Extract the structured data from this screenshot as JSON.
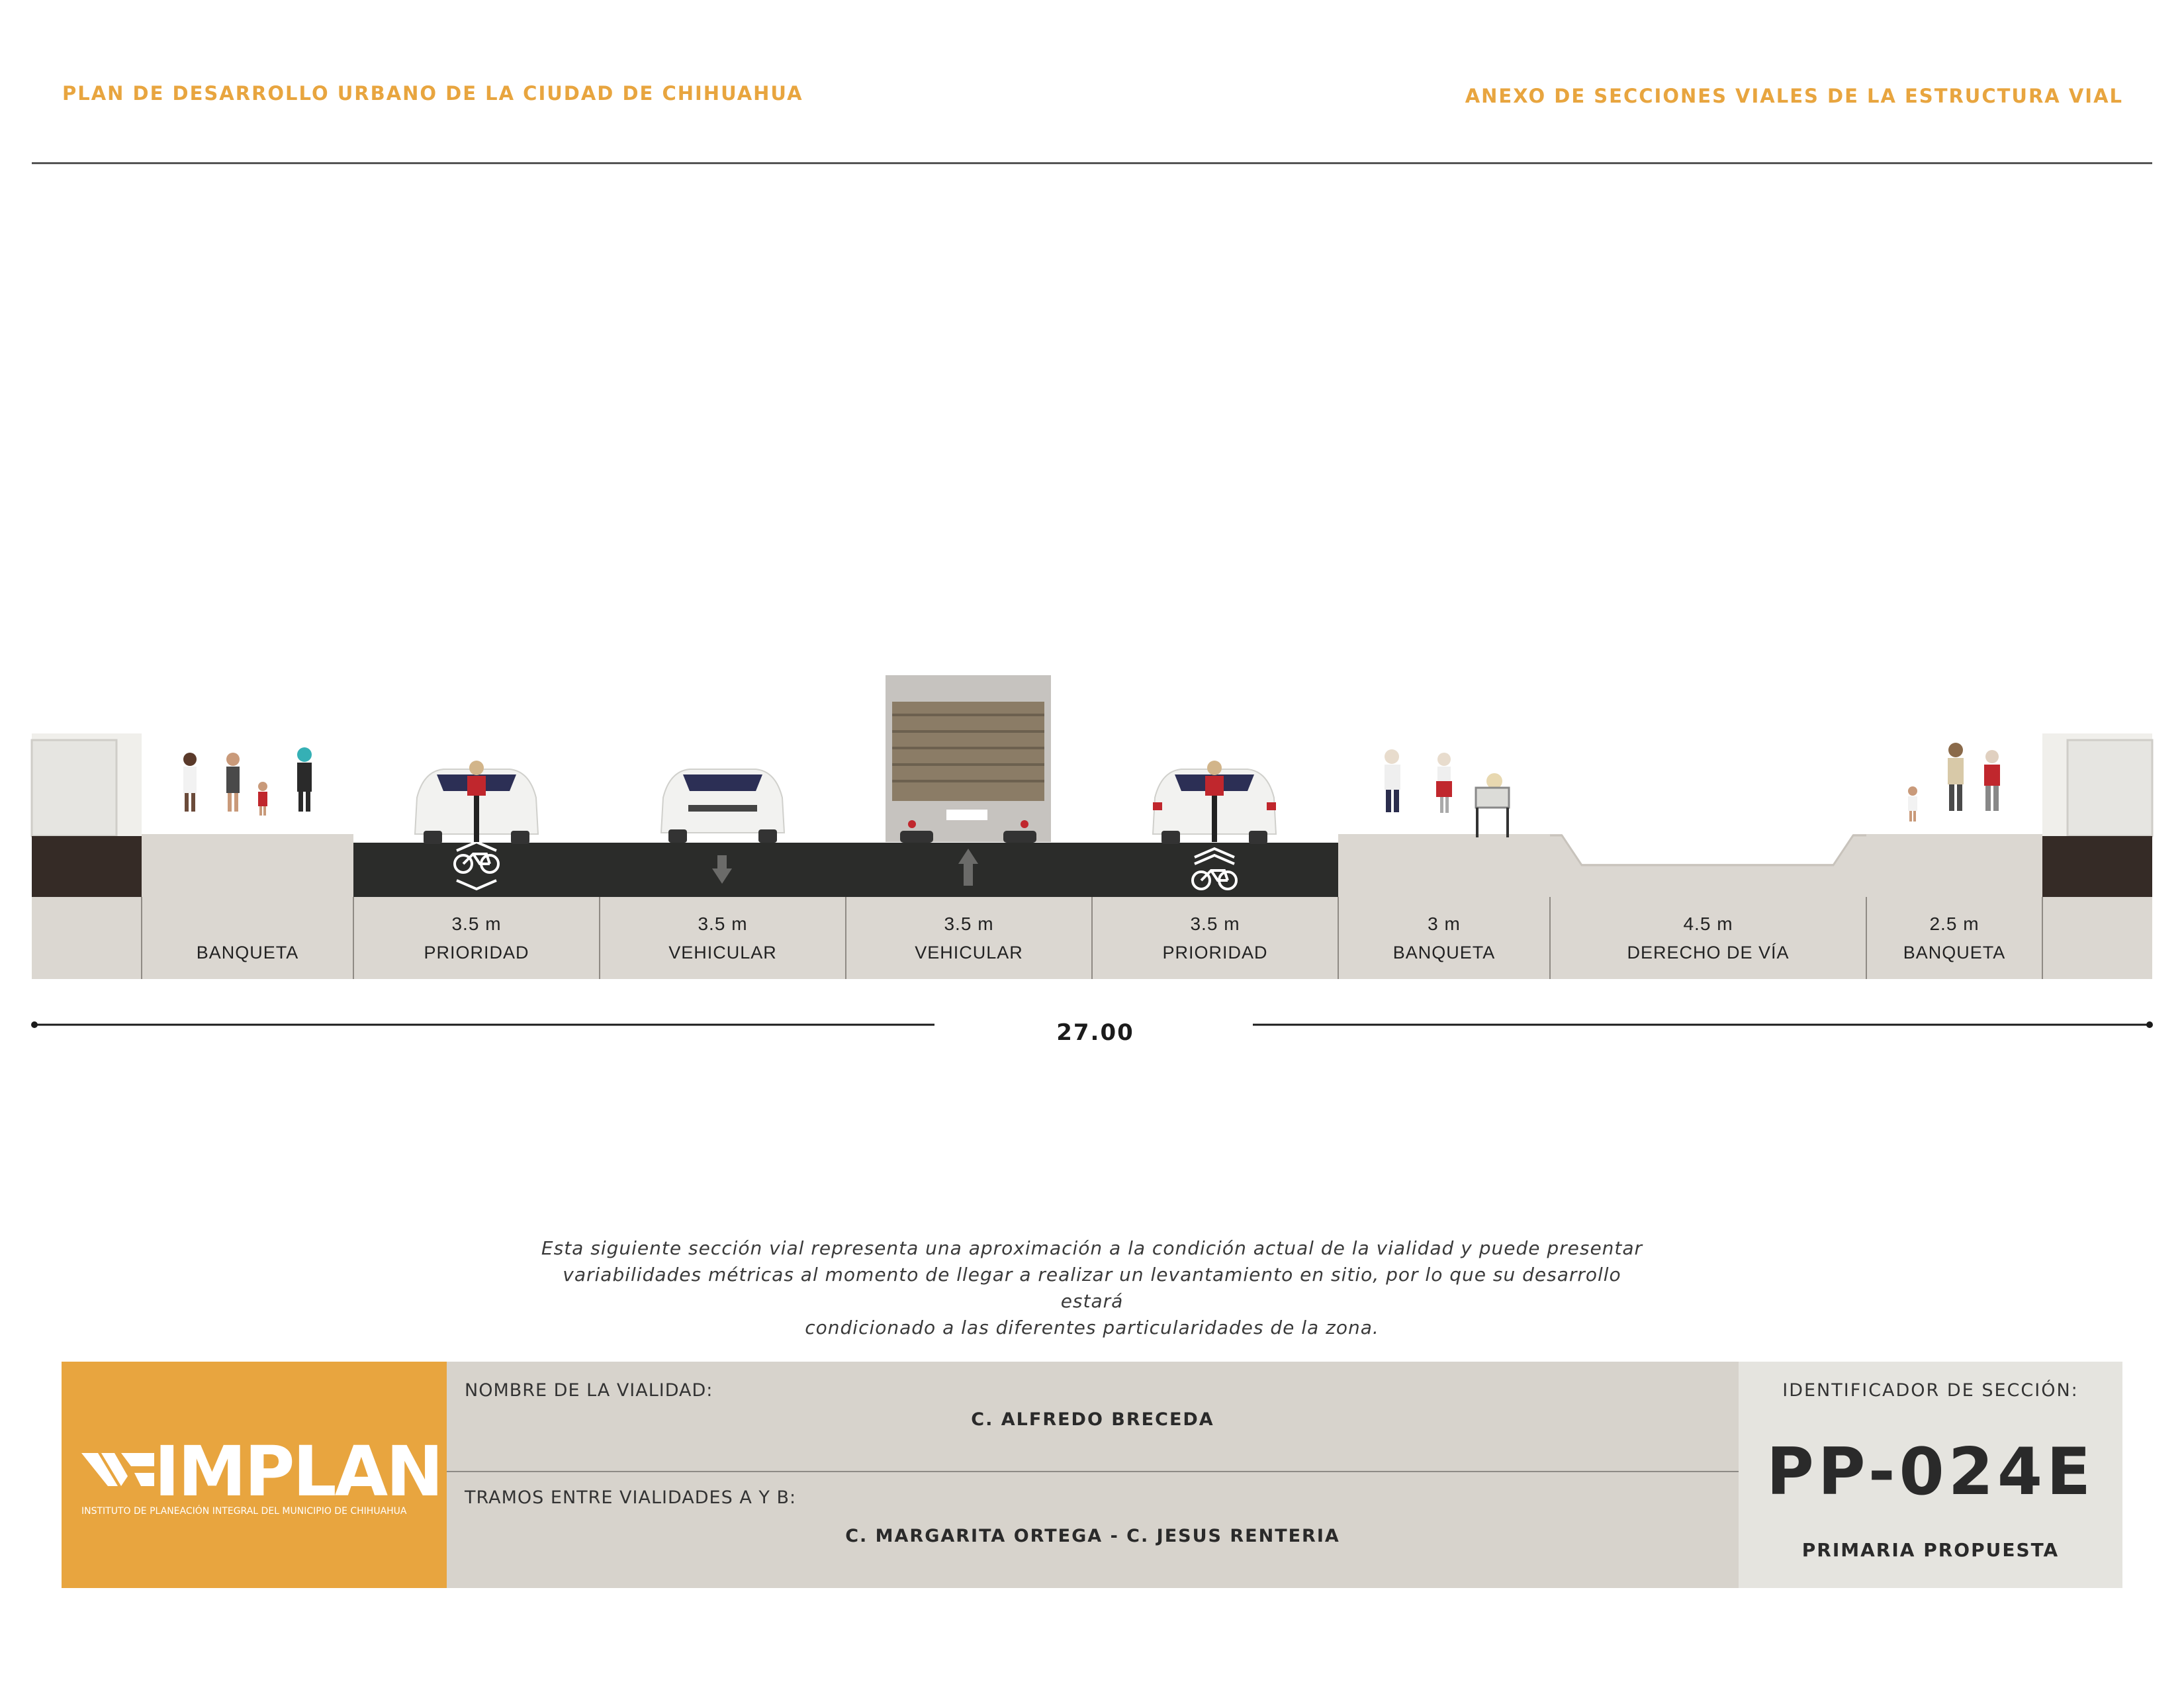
{
  "header": {
    "left_title": "PLAN DE DESARROLLO URBANO DE LA CIUDAD DE CHIHUAHUA",
    "right_title": "ANEXO DE SECCIONES VIALES DE LA ESTRUCTURA VIAL"
  },
  "section": {
    "segments": [
      {
        "width": "",
        "name": "BANQUETA"
      },
      {
        "width": "3.5 m",
        "name": "PRIORIDAD"
      },
      {
        "width": "3.5 m",
        "name": "VEHICULAR"
      },
      {
        "width": "3.5 m",
        "name": "VEHICULAR"
      },
      {
        "width": "3.5 m",
        "name": "PRIORIDAD"
      },
      {
        "width": "3 m",
        "name": "BANQUETA"
      },
      {
        "width": "4.5 m",
        "name": "DERECHO DE VÍA"
      },
      {
        "width": "2.5 m",
        "name": "BANQUETA"
      }
    ],
    "total_width": "27.00",
    "lane_markings": [
      "bike-sharrow-icon",
      "arrow-down-icon",
      "arrow-up-icon",
      "bike-sharrow-icon"
    ]
  },
  "disclaimer": {
    "line1": "Esta siguiente sección vial representa una aproximación a la condición actual de la vialidad y puede presentar",
    "line2": "variabilidades métricas al momento de llegar a realizar un levantamiento en sitio, por lo que su desarrollo estará",
    "line3": "condicionado a las diferentes particularidades de la zona."
  },
  "info": {
    "logo_text": "IMPLAN",
    "logo_subtitle": "INSTITUTO DE PLANEACIÓN INTEGRAL DEL MUNICIPIO DE CHIHUAHUA",
    "road_name_label": "NOMBRE DE LA VIALIDAD:",
    "road_name": "C. ALFREDO BRECEDA",
    "segment_label": "TRAMOS ENTRE VIALIDADES A Y B:",
    "segment_value": "C. MARGARITA ORTEGA - C. JESUS RENTERIA",
    "id_label": "IDENTIFICADOR DE SECCIÓN:",
    "id_code": "PP-024E",
    "classification": "PRIMARIA PROPUESTA"
  },
  "colors": {
    "accent": "#e8a53f",
    "asphalt": "#2b2c2a",
    "sidewalk": "#dbd7d1",
    "building_base": "#352b26"
  }
}
